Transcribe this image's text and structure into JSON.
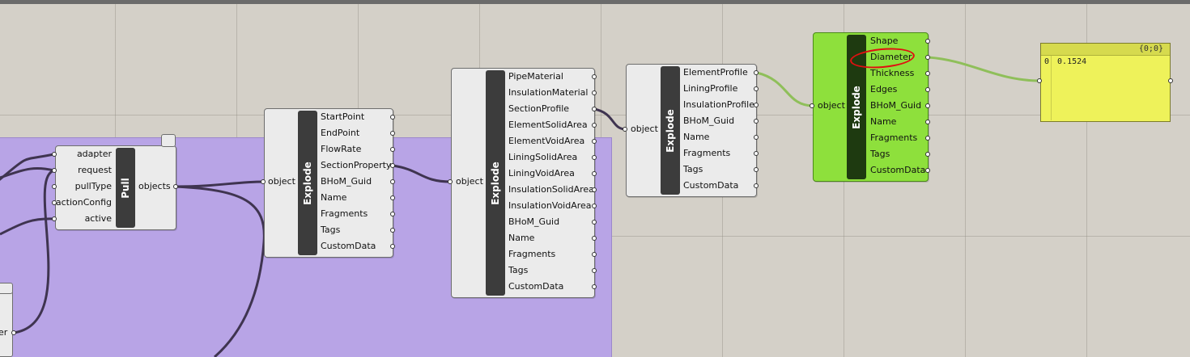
{
  "pull": {
    "name": "Pull",
    "inputs": [
      "adapter",
      "request",
      "pullType",
      "actionConfig",
      "active"
    ],
    "outputs": [
      "objects"
    ]
  },
  "explode1": {
    "name": "Explode",
    "inputs": [
      "object"
    ],
    "outputs": [
      "StartPoint",
      "EndPoint",
      "FlowRate",
      "SectionProperty",
      "BHoM_Guid",
      "Name",
      "Fragments",
      "Tags",
      "CustomData"
    ]
  },
  "explode2": {
    "name": "Explode",
    "inputs": [
      "object"
    ],
    "outputs": [
      "PipeMaterial",
      "InsulationMaterial",
      "SectionProfile",
      "ElementSolidArea",
      "ElementVoidArea",
      "LiningSolidArea",
      "LiningVoidArea",
      "InsulationSolidArea",
      "InsulationVoidArea",
      "BHoM_Guid",
      "Name",
      "Fragments",
      "Tags",
      "CustomData"
    ]
  },
  "explode3": {
    "name": "Explode",
    "inputs": [
      "object"
    ],
    "outputs": [
      "ElementProfile",
      "LiningProfile",
      "InsulationProfile",
      "BHoM_Guid",
      "Name",
      "Fragments",
      "Tags",
      "CustomData"
    ]
  },
  "explode4": {
    "name": "Explode",
    "inputs": [
      "object"
    ],
    "outputs": [
      "Shape",
      "Diameter",
      "Thickness",
      "Edges",
      "BHoM_Guid",
      "Name",
      "Fragments",
      "Tags",
      "CustomData"
    ]
  },
  "panel": {
    "path": "{0;0}",
    "index": "0",
    "value": "0.1524"
  },
  "left_stub_label": "er",
  "colors": {
    "group": "#b8a4e6",
    "selected_component": "#8ee03c",
    "panel": "#eef25a",
    "highlight": "#e01010"
  }
}
